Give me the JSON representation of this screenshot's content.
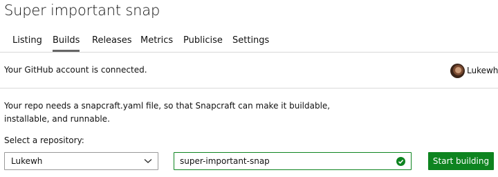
{
  "page": {
    "title": "Super important snap"
  },
  "tabs": [
    {
      "label": "Listing",
      "active": false
    },
    {
      "label": "Builds",
      "active": true
    },
    {
      "label": "Releases",
      "active": false
    },
    {
      "label": "Metrics",
      "active": false
    },
    {
      "label": "Publicise",
      "active": false
    },
    {
      "label": "Settings",
      "active": false
    }
  ],
  "github": {
    "status_text": "Your GitHub account is connected.",
    "username": "Lukewh",
    "avatar_icon": "user-avatar"
  },
  "info": {
    "message": "Your repo needs a snapcraft.yaml file, so that Snapcraft can make it buildable, installable, and runnable."
  },
  "repository": {
    "label": "Select a repository:",
    "owner_selected": "Lukewh",
    "repo_name": "super-important-snap",
    "valid_icon": "check-circle-icon"
  },
  "actions": {
    "start_label": "Start building"
  },
  "colors": {
    "accent": "#0e8420",
    "rule": "#d9d9d9",
    "text": "#111111"
  }
}
